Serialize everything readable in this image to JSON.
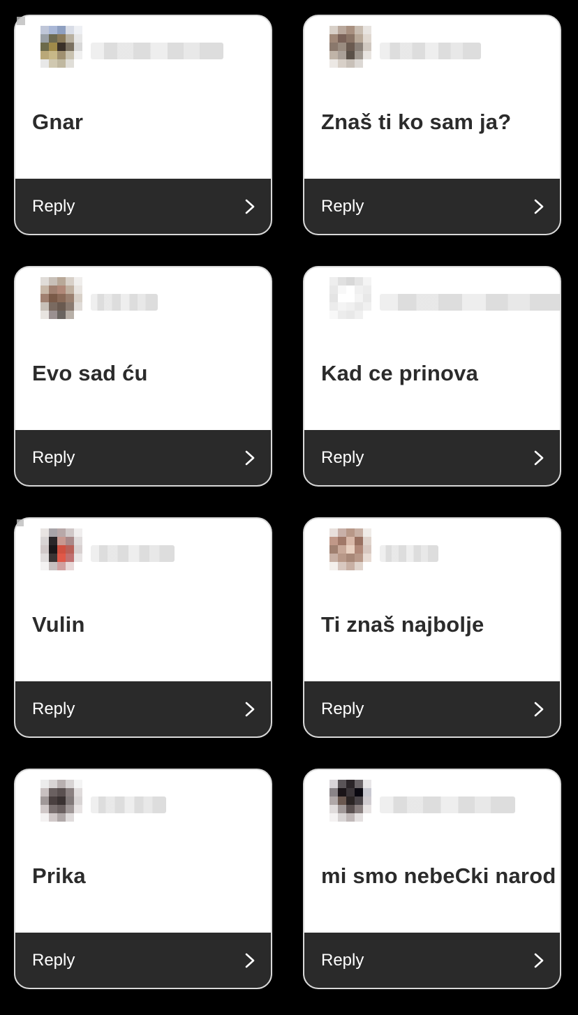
{
  "cards": [
    {
      "message": "Gnar",
      "reply": "Reply",
      "avatar": [
        "#bfc6d8",
        "#a9b7d6",
        "#8e9fc0",
        "#d8dce6",
        "#eef0f4",
        "#9aa0a6",
        "#6d6a52",
        "#8a7a5a",
        "#b8b0a0",
        "#e6e6e6",
        "#6c6a4a",
        "#a08a4a",
        "#3a3028",
        "#7a7060",
        "#d8d8d8",
        "#b9a878",
        "#c8b888",
        "#a09070",
        "#c9c2b0",
        "#f0f0f0",
        "#e8e8e8",
        "#d0c8b0",
        "#c0b8a0",
        "#e0ded8",
        "#ffffff"
      ],
      "name_width": 190
    },
    {
      "message": "Znaš ti ko sam ja?",
      "reply": "Reply",
      "avatar": [
        "#d8d0c8",
        "#b9a89c",
        "#a89080",
        "#c8bcb0",
        "#e8e4e0",
        "#a08878",
        "#7a6258",
        "#8a7466",
        "#b8a898",
        "#e0d8d0",
        "#8a786c",
        "#9a8c80",
        "#6a5a50",
        "#8a8078",
        "#d0c8c0",
        "#c0b4a8",
        "#aaa098",
        "#5a5048",
        "#a09890",
        "#e8e4e0",
        "#ece8e4",
        "#d8d0c8",
        "#c8c0b8",
        "#dcd8d4",
        "#ffffff"
      ],
      "name_width": 145
    },
    {
      "message": "Evo sad ću",
      "reply": "Reply",
      "avatar": [
        "#e0dcd8",
        "#c8c0b8",
        "#b8a898",
        "#d8d0c8",
        "#f0eeec",
        "#c8b8a8",
        "#a08070",
        "#b08878",
        "#c0b0a0",
        "#e8e4e0",
        "#a08070",
        "#7a5a48",
        "#8a6a58",
        "#9a8070",
        "#d8d0c8",
        "#c8c0b8",
        "#7a6a60",
        "#6a5a50",
        "#8a7a70",
        "#e0dcd8",
        "#e8e4e0",
        "#9a9090",
        "#6a6460",
        "#b8b0a8",
        "#ffffff"
      ],
      "name_width": 96
    },
    {
      "message": "Kad ce prinova",
      "reply": "Reply",
      "avatar": [
        "#eeeeee",
        "#e0e0e0",
        "#d8d8d8",
        "#e4e4e4",
        "#f4f4f4",
        "#e8e8e8",
        "#f8f8f8",
        "#ffffff",
        "#f0f0f0",
        "#ececec",
        "#e4e4e4",
        "#ffffff",
        "#ffffff",
        "#f4f4f4",
        "#e8e8e8",
        "#ececec",
        "#f4f4f4",
        "#f0f0f0",
        "#e8e8e8",
        "#f0f0f0",
        "#f8f8f8",
        "#ececec",
        "#e8e8e8",
        "#f0f0f0",
        "#ffffff"
      ],
      "name_width": 262
    },
    {
      "message": "Vulin",
      "reply": "Reply",
      "avatar": [
        "#e8e4e2",
        "#a8a4a8",
        "#b8a8a8",
        "#d0c8c8",
        "#f0eeee",
        "#d8d4d4",
        "#2a2628",
        "#c89890",
        "#a88888",
        "#e0dcdc",
        "#d0c8c8",
        "#1a1618",
        "#d05040",
        "#b86058",
        "#d8d0d0",
        "#e0dcdc",
        "#3a3434",
        "#e05848",
        "#c07070",
        "#e8e4e4",
        "#f4f2f2",
        "#c8c0c0",
        "#d0a0a0",
        "#e8d8d8",
        "#ffffff"
      ],
      "name_width": 120
    },
    {
      "message": "Ti znaš najbolje",
      "reply": "Reply",
      "avatar": [
        "#e8e0dc",
        "#c8b0a8",
        "#b89888",
        "#c8b0a4",
        "#f0ece8",
        "#c09888",
        "#a07868",
        "#d8b8a8",
        "#987060",
        "#e0d4cc",
        "#a08070",
        "#c8a898",
        "#e8d0c0",
        "#b08878",
        "#d8c8c0",
        "#c8b0a4",
        "#b89888",
        "#a88878",
        "#b89888",
        "#e8dcd4",
        "#f4f0ec",
        "#d8c8c0",
        "#c8b0a4",
        "#e0d4cc",
        "#ffffff"
      ],
      "name_width": 84
    },
    {
      "message": "Prika",
      "reply": "Reply",
      "avatar": [
        "#ececec",
        "#d8d4d4",
        "#b8b0b0",
        "#d8d4d4",
        "#f4f4f4",
        "#c8c0c0",
        "#6a6060",
        "#5a5050",
        "#8a8080",
        "#e0dcdc",
        "#a09898",
        "#4a4040",
        "#3a3232",
        "#807878",
        "#d8d4d4",
        "#d0c8c8",
        "#7a7070",
        "#6a6060",
        "#a09898",
        "#e8e4e4",
        "#f4f2f2",
        "#d0c8c8",
        "#b0a8a8",
        "#e0dcdc",
        "#ffffff"
      ],
      "name_width": 108
    },
    {
      "message": "mi smo nebeCki narod",
      "reply": "Reply",
      "avatar": [
        "#d8d4d8",
        "#5a5458",
        "#2a2428",
        "#6a6468",
        "#e8e6e8",
        "#8a8488",
        "#1a1418",
        "#3a3438",
        "#0a0810",
        "#c8c8d0",
        "#b0a8a8",
        "#6a5850",
        "#2a2424",
        "#4a4448",
        "#d0ccd0",
        "#e0dcdc",
        "#a09898",
        "#5a5050",
        "#8a8080",
        "#e8e4e4",
        "#f4f2f2",
        "#d8d4d4",
        "#c0b8b8",
        "#e4e0e0",
        "#ffffff"
      ],
      "name_width": 194
    }
  ]
}
